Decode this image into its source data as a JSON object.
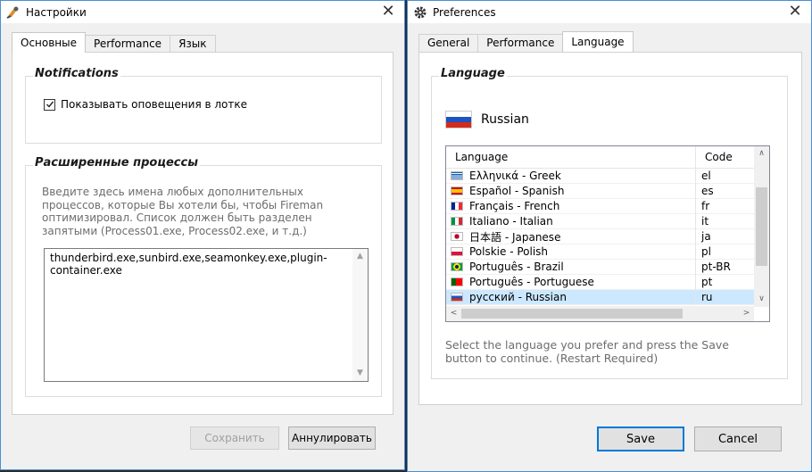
{
  "left_window": {
    "title": "Настройки",
    "tabs": [
      {
        "label": "Основные",
        "active": true
      },
      {
        "label": "Performance",
        "active": false
      },
      {
        "label": "Язык",
        "active": false
      }
    ],
    "notifications": {
      "title": "Notifications",
      "checkbox_label": "Показывать оповещения в лотке",
      "checked": true
    },
    "processes": {
      "title": "Расширенные процессы",
      "hint": "Введите здесь имена любых дополнительных процессов, которые Вы хотели бы, чтобы Fireman оптимизировал. Список должен быть разделен запятыми (Process01.exe, Process02.exe, и т.д.)",
      "value": "thunderbird.exe,sunbird.exe,seamonkey.exe,plugin-container.exe"
    },
    "buttons": {
      "save": "Сохранить",
      "cancel": "Аннулировать"
    }
  },
  "right_window": {
    "title": "Preferences",
    "tabs": [
      {
        "label": "General",
        "active": false
      },
      {
        "label": "Performance",
        "active": false
      },
      {
        "label": "Language",
        "active": true
      }
    ],
    "group_title": "Language",
    "current_language": "Russian",
    "list": {
      "col_language": "Language",
      "col_code": "Code",
      "rows": [
        {
          "name": "Ελληνικά - Greek",
          "code": "el",
          "flag": "gr"
        },
        {
          "name": "Español - Spanish",
          "code": "es",
          "flag": "es"
        },
        {
          "name": "Français - French",
          "code": "fr",
          "flag": "fr"
        },
        {
          "name": "Italiano - Italian",
          "code": "it",
          "flag": "it"
        },
        {
          "name": "日本語 - Japanese",
          "code": "ja",
          "flag": "jp"
        },
        {
          "name": "Polskie - Polish",
          "code": "pl",
          "flag": "pl"
        },
        {
          "name": "Português - Brazil",
          "code": "pt-BR",
          "flag": "br"
        },
        {
          "name": "Português - Portuguese",
          "code": "pt",
          "flag": "pt"
        },
        {
          "name": "русский - Russian",
          "code": "ru",
          "flag": "ru",
          "selected": true
        }
      ]
    },
    "instruction": "Select the language you prefer and press the Save button to continue. (Restart Required)",
    "buttons": {
      "save": "Save",
      "cancel": "Cancel"
    }
  }
}
